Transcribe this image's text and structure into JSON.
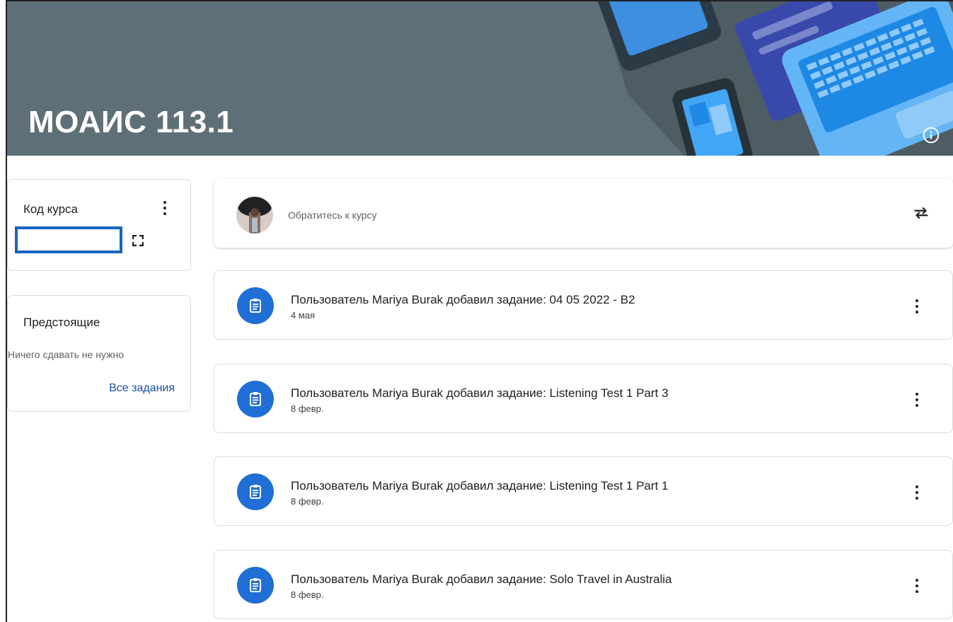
{
  "course": {
    "title": "МОАИС 113.1"
  },
  "code_card": {
    "title": "Код курса"
  },
  "upcoming": {
    "title": "Предстоящие",
    "empty_text": "Ничего сдавать не нужно",
    "all_link": "Все задания"
  },
  "announce": {
    "placeholder": "Обратитесь к курсу"
  },
  "posts": [
    {
      "title": "Пользователь Mariya Burak добавил задание: 04 05 2022 - B2",
      "date": "4 мая"
    },
    {
      "title": "Пользователь Mariya Burak добавил задание: Listening Test 1 Part 3",
      "date": "8 февр."
    },
    {
      "title": "Пользователь Mariya Burak добавил задание: Listening Test 1 Part 1",
      "date": "8 февр."
    },
    {
      "title": "Пользователь Mariya Burak добавил задание: Solo Travel in Australia",
      "date": "8 февр."
    }
  ],
  "icons": {
    "info": "info-icon",
    "more": "more-vert-icon",
    "expand": "fullscreen-icon",
    "repost": "repost-icon",
    "assignment": "assignment-icon"
  },
  "colors": {
    "banner": "#5f6f78",
    "accent": "#1f6fd6",
    "link": "#174ea6"
  }
}
